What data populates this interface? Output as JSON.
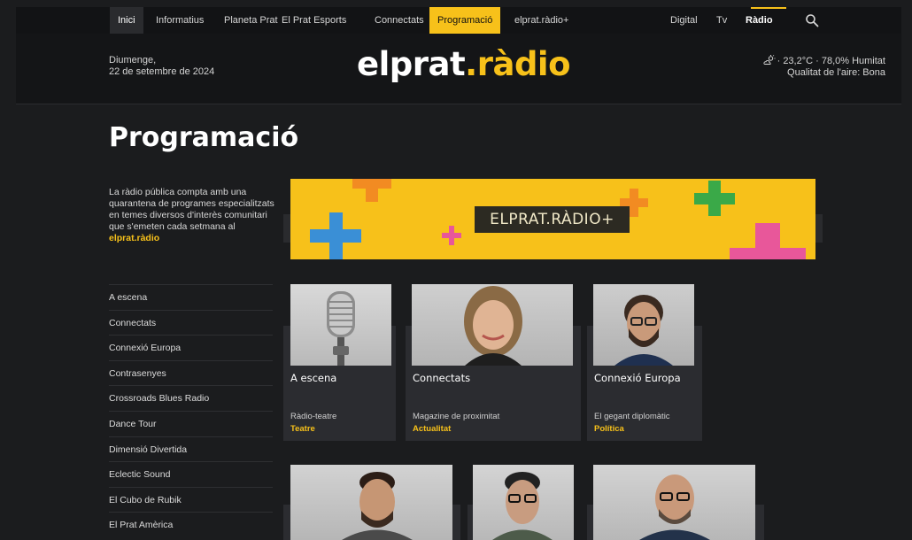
{
  "nav": {
    "items": [
      "Inici",
      "Informatius",
      "Planeta Prat",
      "El Prat Esports",
      "Connectats",
      "Programació",
      "elprat.ràdio+"
    ],
    "right": [
      "Digital",
      "Tv",
      "Ràdio"
    ],
    "search_icon": "search-icon"
  },
  "header": {
    "date_day": "Diumenge,",
    "date_full": "22 de setembre de 2024",
    "logo_main": "elprat",
    "logo_dot": ".",
    "logo_accent": "ràdio",
    "weather_line": "· 23,2°C · 78,0% Humitat",
    "air_quality": "Qualitat de l'aire: Bona",
    "weather_icon": "partly-cloudy-icon"
  },
  "page": {
    "title": "Programació",
    "intro": "La ràdio pública compta amb una quarantena de programes especialitzats en temes diversos d'interès comunitari que s'emeten cada setmana al",
    "intro_brand": "elprat.ràdio"
  },
  "sidebar": {
    "items": [
      "A escena",
      "Connectats",
      "Connexió Europa",
      "Contrasenyes",
      "Crossroads Blues Radio",
      "Dance Tour",
      "Dimensió Divertida",
      "Eclectic Sound",
      "El Cubo de Rubik",
      "El Prat Amèrica"
    ]
  },
  "banner": {
    "text": "ELPRAT.RÀDIO+",
    "colors": {
      "bg": "#f7c11a",
      "blue": "#3a8fd6",
      "orange": "#f28b22",
      "green": "#3aa948",
      "pink": "#e8579a"
    }
  },
  "cards": [
    {
      "title": "A escena",
      "subtitle": "Ràdio-teatre",
      "category": "Teatre",
      "image": "microphone"
    },
    {
      "title": "Connectats",
      "subtitle": "Magazine de proximitat",
      "category": "Actualitat",
      "image": "woman-portrait"
    },
    {
      "title": "Connexió Europa",
      "subtitle": "El gegant diplomàtic",
      "category": "Política",
      "image": "man-glasses-portrait"
    }
  ],
  "colors": {
    "accent": "#f7c11a",
    "bg": "#1b1c1e",
    "card": "#2b2c30"
  }
}
